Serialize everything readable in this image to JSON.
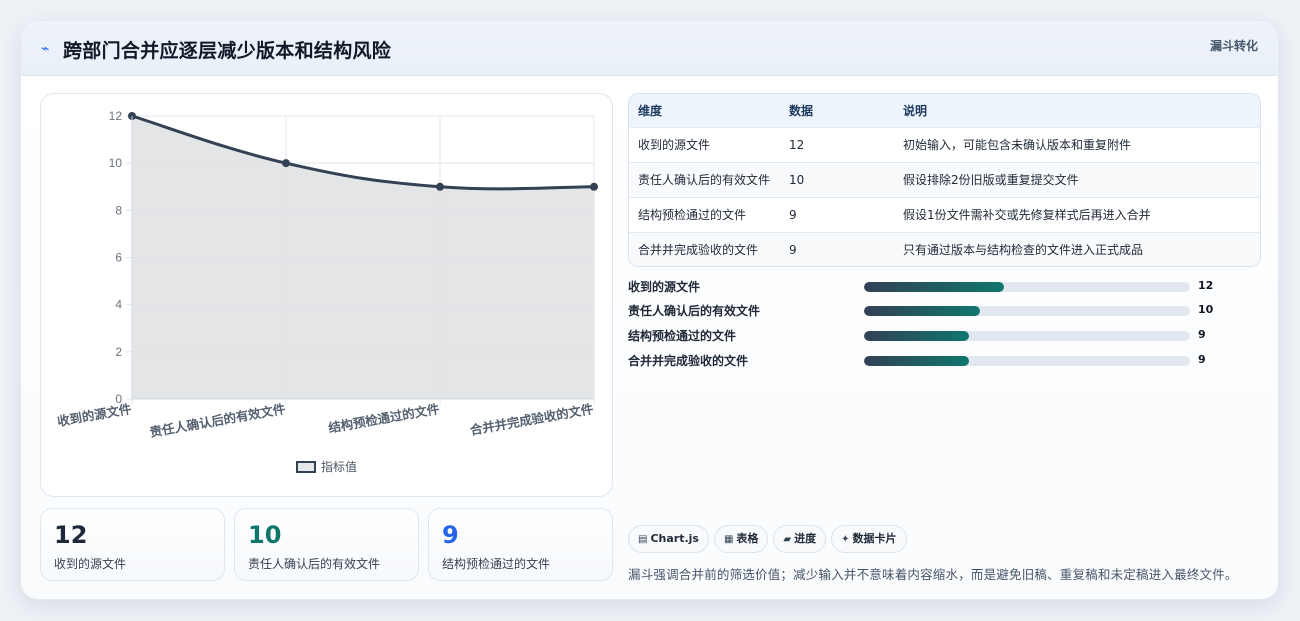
{
  "header": {
    "title_icon": "⌁",
    "title": "跨部门合并应逐层减少版本和结构风险",
    "tag": "漏斗转化"
  },
  "chart_data": {
    "type": "line",
    "categories": [
      "收到的源文件",
      "责任人确认后的有效文件",
      "结构预检通过的文件",
      "合并并完成验收的文件"
    ],
    "series": [
      {
        "name": "指标值",
        "values": [
          12,
          10,
          9,
          9
        ]
      }
    ],
    "ylim": [
      0,
      12
    ],
    "yticks": [
      0,
      2,
      4,
      6,
      8,
      10,
      12
    ],
    "fill": true,
    "grid": true,
    "legend": "bottom",
    "colors": {
      "line": "#334155",
      "fill": "#e3e4e6",
      "grid": "#dfe5ee"
    }
  },
  "stats": [
    {
      "value": "12",
      "label": "收到的源文件",
      "color": "#1e293b"
    },
    {
      "value": "10",
      "label": "责任人确认后的有效文件",
      "color": "#0f766e"
    },
    {
      "value": "9",
      "label": "结构预检通过的文件",
      "color": "#2563eb"
    }
  ],
  "table": {
    "headers": [
      "维度",
      "数据",
      "说明"
    ],
    "rows": [
      [
        "收到的源文件",
        "12",
        "初始输入，可能包含未确认版本和重复附件"
      ],
      [
        "责任人确认后的有效文件",
        "10",
        "假设排除2份旧版或重复提交文件"
      ],
      [
        "结构预检通过的文件",
        "9",
        "假设1份文件需补交或先修复样式后再进入合并"
      ],
      [
        "合并并完成验收的文件",
        "9",
        "只有通过版本与结构检查的文件进入正式成品"
      ]
    ]
  },
  "progress": {
    "max": 28,
    "items": [
      {
        "label": "收到的源文件",
        "value": 12
      },
      {
        "label": "责任人确认后的有效文件",
        "value": 10
      },
      {
        "label": "结构预检通过的文件",
        "value": 9
      },
      {
        "label": "合并并完成验收的文件",
        "value": 9
      }
    ]
  },
  "chips": [
    {
      "icon": "▤",
      "label": "Chart.js"
    },
    {
      "icon": "▦",
      "label": "表格"
    },
    {
      "icon": "▰",
      "label": "进度"
    },
    {
      "icon": "✦",
      "label": "数据卡片"
    }
  ],
  "note": "漏斗强调合并前的筛选价值；减少输入并不意味着内容缩水，而是避免旧稿、重复稿和未定稿进入最终文件。"
}
